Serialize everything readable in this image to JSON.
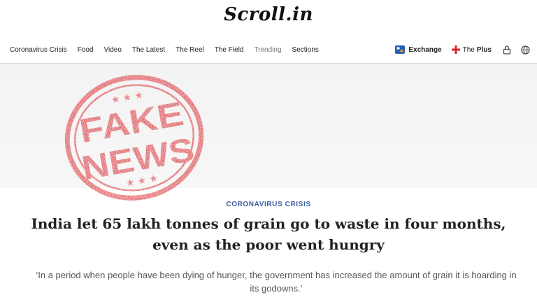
{
  "brand": {
    "logo_text": "Scroll.in"
  },
  "nav": {
    "items": [
      {
        "label": "Coronavirus Crisis"
      },
      {
        "label": "Food"
      },
      {
        "label": "Video"
      },
      {
        "label": "The Latest"
      },
      {
        "label": "The Reel"
      },
      {
        "label": "The Field"
      },
      {
        "label": "Trending"
      },
      {
        "label": "Sections"
      }
    ],
    "exchange_label": "Exchange",
    "plus_prefix": "The",
    "plus_label": "Plus",
    "icons": [
      "exchange-icon",
      "plus-cross-icon",
      "user-lock-icon",
      "language-icon"
    ]
  },
  "stamp": {
    "line1": "FAKE",
    "line2": "NEWS",
    "color": "#d8262c"
  },
  "article": {
    "kicker": "CORONAVIRUS CRISIS",
    "headline_line1": "India let 65 lakh tonnes of grain go to waste in four months,",
    "headline_line2": "even as the poor went hungry",
    "dek_line1": "‘In a period when people have been dying of hunger, the government has increased the amount of grain it is hoarding in",
    "dek_line2": "its godowns.’"
  },
  "colors": {
    "kicker": "#3a5d9c",
    "stamp": "#d8262c",
    "hero_bg": "#f3f3f3"
  }
}
